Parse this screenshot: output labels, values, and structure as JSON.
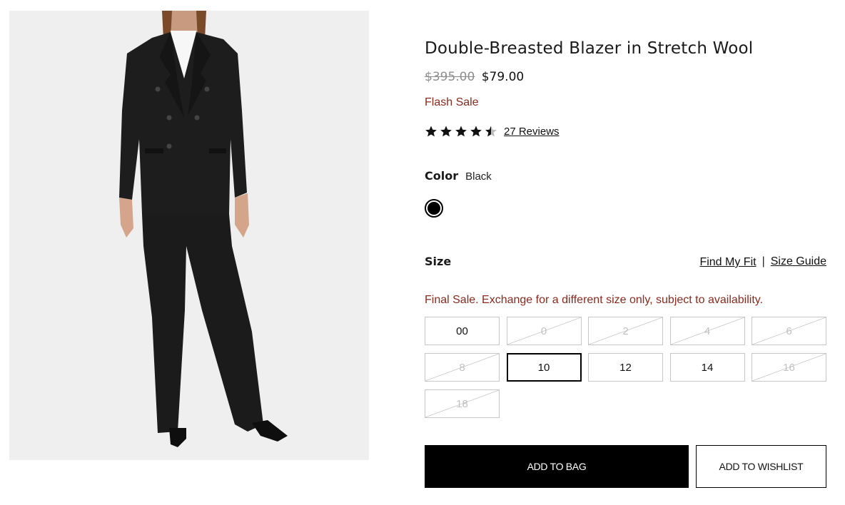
{
  "product": {
    "title": "Double-Breasted Blazer in Stretch Wool",
    "price_original": "$395.00",
    "price_sale": "$79.00",
    "badge": "Flash Sale",
    "rating": 4.5,
    "reviews_link": "27 Reviews"
  },
  "color": {
    "label": "Color",
    "value": "Black",
    "swatch_hex": "#000000"
  },
  "size": {
    "label": "Size",
    "find_my_fit": "Find My Fit",
    "separator": "|",
    "size_guide": "Size Guide",
    "final_sale_notice": "Final Sale. Exchange for a different size only, subject to availability.",
    "options": [
      {
        "label": "00",
        "available": true,
        "selected": false
      },
      {
        "label": "0",
        "available": false,
        "selected": false
      },
      {
        "label": "2",
        "available": false,
        "selected": false
      },
      {
        "label": "4",
        "available": false,
        "selected": false
      },
      {
        "label": "6",
        "available": false,
        "selected": false
      },
      {
        "label": "8",
        "available": false,
        "selected": false
      },
      {
        "label": "10",
        "available": true,
        "selected": true
      },
      {
        "label": "12",
        "available": true,
        "selected": false
      },
      {
        "label": "14",
        "available": true,
        "selected": false
      },
      {
        "label": "16",
        "available": false,
        "selected": false
      },
      {
        "label": "18",
        "available": false,
        "selected": false
      }
    ]
  },
  "actions": {
    "add_to_bag": "ADD TO BAG",
    "add_to_wishlist": "ADD TO WISHLIST"
  },
  "colors": {
    "sale_red": "#8c2a1e",
    "image_bg": "#efefef"
  }
}
